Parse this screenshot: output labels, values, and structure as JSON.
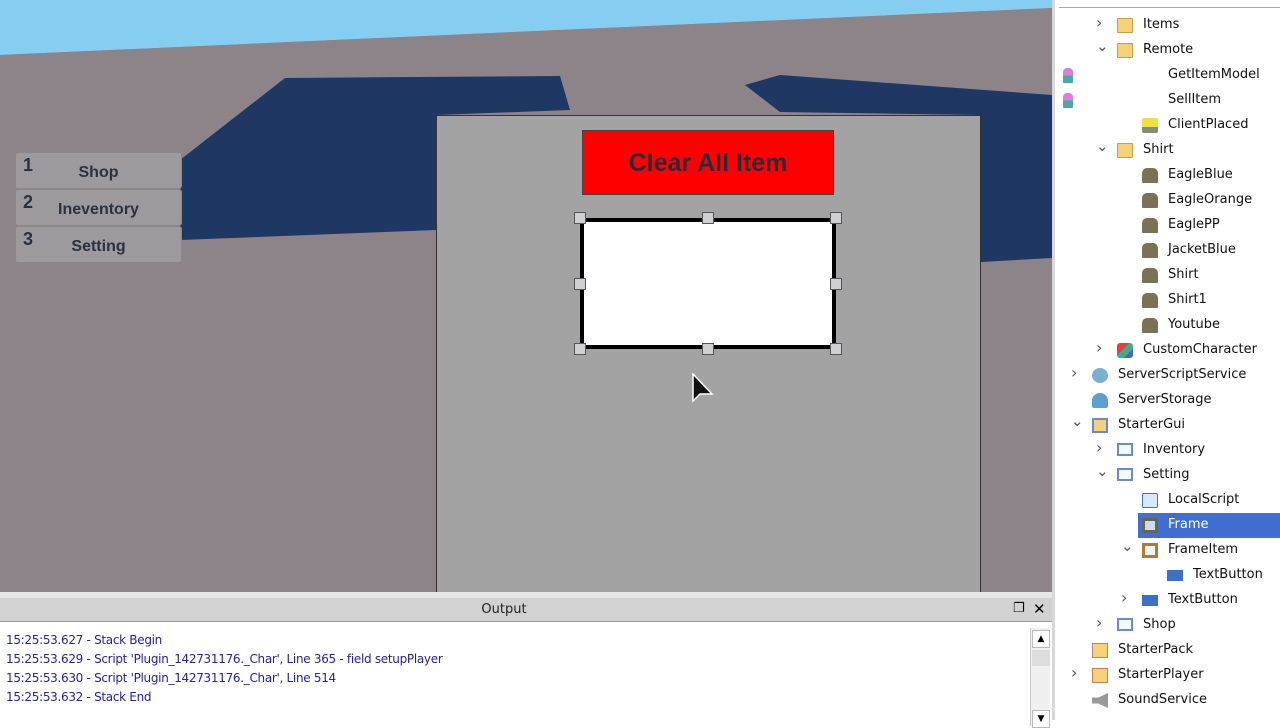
{
  "viewport": {
    "hotbar": [
      {
        "num": "1",
        "label": "Shop"
      },
      {
        "num": "2",
        "label": "Ineventory"
      },
      {
        "num": "3",
        "label": "Setting"
      }
    ],
    "clear_button_label": "Clear All Item",
    "colors": {
      "sky": "#7ec8f0",
      "baseplate": "#8c8489",
      "walls": "#1e3763",
      "clear_button": "#ff0000",
      "selection": "#3f6fd0"
    }
  },
  "output": {
    "title": "Output",
    "lines": [
      "15:25:53.627 - Stack Begin",
      "15:25:53.629 - Script 'Plugin_142731176._Char', Line 365 - field setupPlayer",
      "15:25:53.630 - Script 'Plugin_142731176._Char', Line 514",
      "15:25:53.632 - Stack End"
    ]
  },
  "explorer": {
    "items": [
      {
        "label": "Items",
        "level": 1,
        "expand": "collapsed",
        "icon": "folder-icon"
      },
      {
        "label": "Remote",
        "level": 1,
        "expand": "expanded",
        "icon": "folder-icon"
      },
      {
        "label": "GetItemModel",
        "level": 2,
        "expand": "",
        "icon": "remote-function-icon"
      },
      {
        "label": "SellItem",
        "level": 2,
        "expand": "",
        "icon": "remote-function-icon"
      },
      {
        "label": "ClientPlaced",
        "level": 2,
        "expand": "",
        "icon": "remote-event-icon"
      },
      {
        "label": "Shirt",
        "level": 1,
        "expand": "expanded",
        "icon": "folder-icon"
      },
      {
        "label": "EagleBlue",
        "level": 2,
        "expand": "",
        "icon": "shirt-icon"
      },
      {
        "label": "EagleOrange",
        "level": 2,
        "expand": "",
        "icon": "shirt-icon"
      },
      {
        "label": "EaglePP",
        "level": 2,
        "expand": "",
        "icon": "shirt-icon"
      },
      {
        "label": "JacketBlue",
        "level": 2,
        "expand": "",
        "icon": "shirt-icon"
      },
      {
        "label": "Shirt",
        "level": 2,
        "expand": "",
        "icon": "shirt-icon"
      },
      {
        "label": "Shirt1",
        "level": 2,
        "expand": "",
        "icon": "shirt-icon"
      },
      {
        "label": "Youtube",
        "level": 2,
        "expand": "",
        "icon": "shirt-icon"
      },
      {
        "label": "CustomCharacter",
        "level": 1,
        "expand": "collapsed",
        "icon": "model-icon"
      },
      {
        "label": "ServerScriptService",
        "level": 0,
        "expand": "collapsed",
        "icon": "server-script-service-icon"
      },
      {
        "label": "ServerStorage",
        "level": 0,
        "expand": "",
        "icon": "server-storage-icon"
      },
      {
        "label": "StarterGui",
        "level": 0,
        "expand": "expanded",
        "icon": "starter-gui-icon"
      },
      {
        "label": "Inventory",
        "level": 1,
        "expand": "collapsed",
        "icon": "screen-gui-icon"
      },
      {
        "label": "Setting",
        "level": 1,
        "expand": "expanded",
        "icon": "screen-gui-icon"
      },
      {
        "label": "LocalScript",
        "level": 2,
        "expand": "",
        "icon": "local-script-icon"
      },
      {
        "label": "Frame",
        "level": 2,
        "expand": "",
        "icon": "frame-icon",
        "selected": true
      },
      {
        "label": "FrameItem",
        "level": 2,
        "expand": "expanded",
        "icon": "frame-item-icon"
      },
      {
        "label": "TextButton",
        "level": 3,
        "expand": "",
        "icon": "text-button-icon"
      },
      {
        "label": "TextButton",
        "level": 2,
        "expand": "collapsed",
        "icon": "text-button-icon"
      },
      {
        "label": "Shop",
        "level": 1,
        "expand": "collapsed",
        "icon": "screen-gui-icon"
      },
      {
        "label": "StarterPack",
        "level": 0,
        "expand": "",
        "icon": "starter-pack-icon"
      },
      {
        "label": "StarterPlayer",
        "level": 0,
        "expand": "collapsed",
        "icon": "starter-player-icon"
      },
      {
        "label": "SoundService",
        "level": 0,
        "expand": "",
        "icon": "sound-service-icon"
      }
    ]
  }
}
